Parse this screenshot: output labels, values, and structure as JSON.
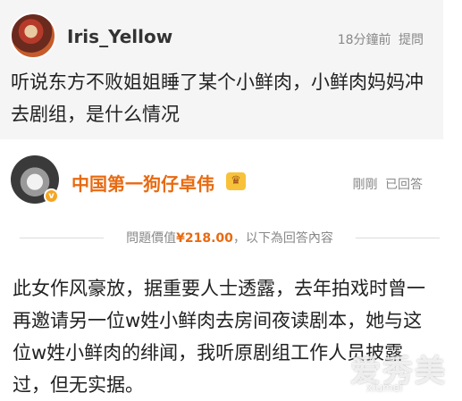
{
  "question": {
    "user_name": "Iris_Yellow",
    "time": "18分鐘前",
    "tag": "提問",
    "text": "听说东方不败姐姐睡了某个小鲜肉，小鲜肉妈妈冲去剧组，是什么情况"
  },
  "answer": {
    "user_name": "中国第一狗仔卓伟",
    "badge_icon": "crown-icon",
    "verify_icon": "v",
    "time": "剛剛",
    "status": "已回答",
    "price_label": "問題價值",
    "price_amount": "¥218.00",
    "price_suffix": "，以下為回答內容",
    "text": "此女作风豪放，据重要人士透露，去年拍戏时曾一再邀请另一位w姓小鲜肉去房间夜读剧本，她与这位w姓小鲜肉的绯闻，我听原剧组工作人员披露过，但无实据。"
  },
  "watermark": {
    "text": "爱秀美",
    "sub": "xiumei"
  },
  "colors": {
    "accent": "#e86a10",
    "question_bg": "#f5f5f5"
  }
}
